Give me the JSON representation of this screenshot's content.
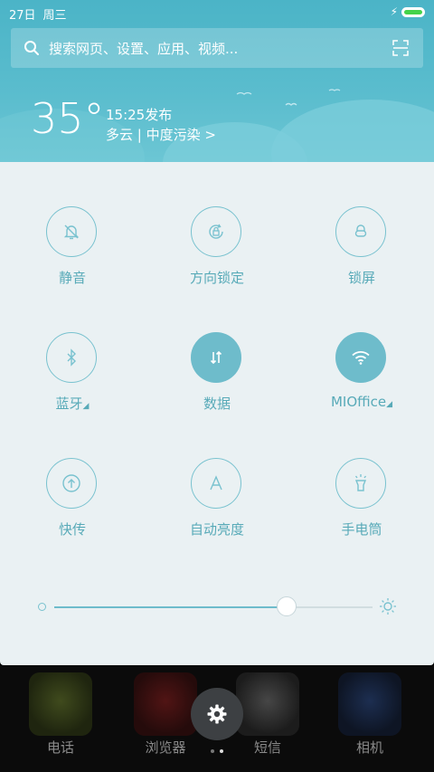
{
  "status_bar": {
    "date": "27日",
    "weekday": "周三"
  },
  "search": {
    "placeholder": "搜索网页、设置、应用、视频..."
  },
  "weather": {
    "temperature": "35°",
    "publish_time": "15:25发布",
    "condition": "多云 | 中度污染 >"
  },
  "toggles": [
    {
      "label": "静音",
      "icon": "bell-off-icon",
      "active": false
    },
    {
      "label": "方向锁定",
      "icon": "rotation-lock-icon",
      "active": false
    },
    {
      "label": "锁屏",
      "icon": "lock-icon",
      "active": false
    },
    {
      "label": "蓝牙",
      "icon": "bluetooth-icon",
      "active": false,
      "has_more": true
    },
    {
      "label": "数据",
      "icon": "data-arrows-icon",
      "active": true
    },
    {
      "label": "MIOffice",
      "icon": "wifi-icon",
      "active": true,
      "has_more": true
    },
    {
      "label": "快传",
      "icon": "share-icon",
      "active": false
    },
    {
      "label": "自动亮度",
      "icon": "auto-brightness-icon",
      "active": false
    },
    {
      "label": "手电筒",
      "icon": "flashlight-icon",
      "active": false
    }
  ],
  "brightness": {
    "level": 0.73
  },
  "dock": {
    "apps": [
      {
        "label": "电话"
      },
      {
        "label": "浏览器"
      },
      {
        "label": "短信"
      },
      {
        "label": "相机"
      }
    ]
  },
  "colors": {
    "accent": "#6ebccb",
    "header": "#5bbdce",
    "panel": "#eaf1f3"
  }
}
